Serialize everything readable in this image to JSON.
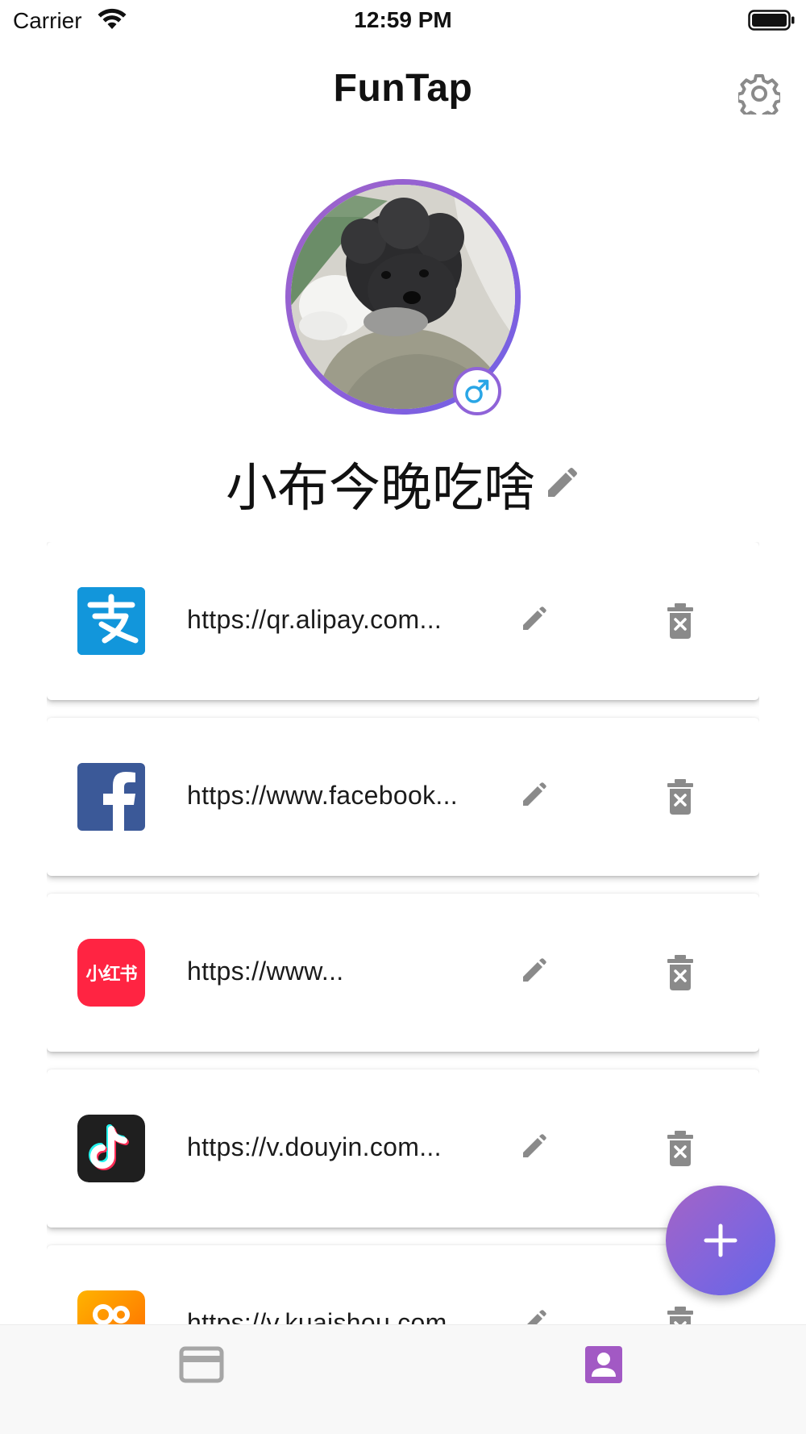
{
  "status_bar": {
    "carrier": "Carrier",
    "time": "12:59 PM"
  },
  "nav": {
    "title": "FunTap",
    "settings_icon": "gear-icon"
  },
  "profile": {
    "name": "小布今晚吃啥",
    "gender_icon": "male-icon",
    "avatar": "dog-photo"
  },
  "links": [
    {
      "platform": "alipay",
      "url": "https://qr.alipay.com...",
      "logo_color": "#1296db"
    },
    {
      "platform": "facebook",
      "url": "https://www.facebook...",
      "logo_color": "#3b5998"
    },
    {
      "platform": "xiaohongshu",
      "url": "https://www...",
      "logo_color": "#ff2442",
      "logo_text": "小红书"
    },
    {
      "platform": "douyin",
      "url": "https://v.douyin.com...",
      "logo_color": "#1f1f1f"
    },
    {
      "platform": "kuaishou",
      "url": "https://v.kuaishou.com...",
      "logo_color": "#ff8a00"
    }
  ],
  "tabs": [
    {
      "id": "cards",
      "icon": "credit-card-icon",
      "active": false
    },
    {
      "id": "profile",
      "icon": "contact-card-icon",
      "active": true
    }
  ],
  "colors": {
    "accent": "#9b59b6",
    "accent_gradient_end": "#6466e8",
    "icon_gray": "#8a8a8a",
    "tab_inactive": "#a6a6a6",
    "tab_active": "#a259c4"
  }
}
